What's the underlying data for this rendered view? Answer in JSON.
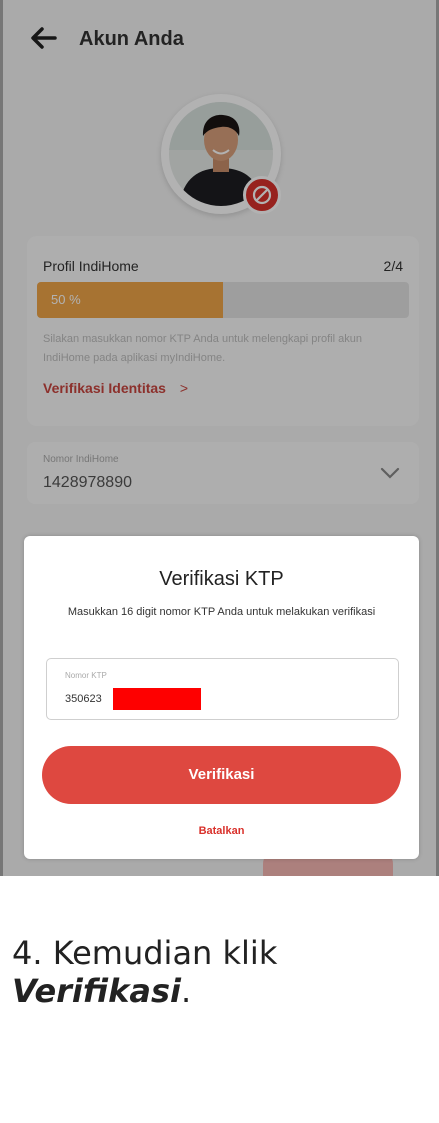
{
  "header": {
    "title": "Akun Anda",
    "back_icon": "arrow-left-icon"
  },
  "profile": {
    "title": "Profil IndiHome",
    "count": "2/4",
    "progress": 0.5,
    "progress_label": "50 %",
    "description": "Silakan masukkan nomor KTP Anda untuk melengkapi profil akun IndiHome pada aplikasi myIndiHome.",
    "verify_link": "Verifikasi Identitas",
    "chevron": ">"
  },
  "indihome": {
    "label": "Nomor IndiHome",
    "value": "1428978890"
  },
  "modal": {
    "title": "Verifikasi KTP",
    "description": "Masukkan 16 digit nomor KTP Anda untuk melakukan verifikasi",
    "ktp_label": "Nomor KTP",
    "ktp_value": "350623",
    "primary_button": "Verifikasi",
    "cancel": "Batalkan"
  },
  "caption": {
    "prefix": "4. Kemudian klik ",
    "bold": "Verifikasi",
    "suffix": "."
  },
  "colors": {
    "accent": "#de4840",
    "progress": "#f0a548",
    "redaction": "#fe0000"
  }
}
